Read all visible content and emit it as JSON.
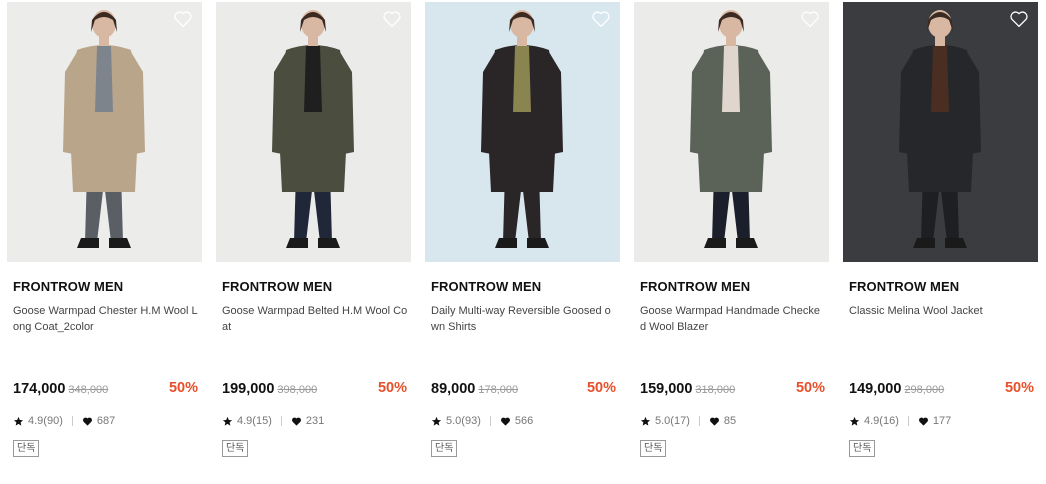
{
  "colors": {
    "discount": "#e8502b",
    "text": "#111111",
    "muted": "#999999"
  },
  "products": [
    {
      "brand": "FRONTROW MEN",
      "name": "Goose Warmpad Chester H.M Wool Long Coat_2color",
      "price": "174,000",
      "original_price": "348,000",
      "discount": "50%",
      "rating": "4.9(90)",
      "likes": "687",
      "tag": "단독",
      "photo": {
        "bg": "#ececeb",
        "coat": "#b9a68a",
        "pants": "#5a5f66",
        "inner": "#7d848c",
        "icon": "heart-outline-icon"
      }
    },
    {
      "brand": "FRONTROW MEN",
      "name": "Goose Warmpad Belted H.M Wool Coat",
      "price": "199,000",
      "original_price": "398,000",
      "discount": "50%",
      "rating": "4.9(15)",
      "likes": "231",
      "tag": "단독",
      "photo": {
        "bg": "#ebebea",
        "coat": "#4b4e3e",
        "pants": "#1f2738",
        "inner": "#1f1f1f",
        "icon": "heart-outline-icon"
      }
    },
    {
      "brand": "FRONTROW MEN",
      "name": "Daily Multi-way Reversible Goosed own Shirts",
      "price": "89,000",
      "original_price": "178,000",
      "discount": "50%",
      "rating": "5.0(93)",
      "likes": "566",
      "tag": "단독",
      "photo": {
        "bg": "#d8e6ee",
        "coat": "#2a2527",
        "pants": "#2a2527",
        "inner": "#8a8450",
        "icon": "heart-outline-icon"
      }
    },
    {
      "brand": "FRONTROW MEN",
      "name": "Goose Warmpad Handmade Checked Wool Blazer",
      "price": "159,000",
      "original_price": "318,000",
      "discount": "50%",
      "rating": "5.0(17)",
      "likes": "85",
      "tag": "단독",
      "photo": {
        "bg": "#ebebea",
        "coat": "#5b6258",
        "pants": "#1a1f2b",
        "inner": "#e0d6cd",
        "icon": "heart-outline-icon"
      }
    },
    {
      "brand": "FRONTROW MEN",
      "name": "Classic Melina Wool Jacket",
      "price": "149,000",
      "original_price": "298,000",
      "discount": "50%",
      "rating": "4.9(16)",
      "likes": "177",
      "tag": "단독",
      "photo": {
        "bg": "#3a3c3f",
        "coat": "#25272a",
        "pants": "#1d1f22",
        "inner": "#4a2e22",
        "icon": "heart-outline-icon"
      }
    }
  ]
}
